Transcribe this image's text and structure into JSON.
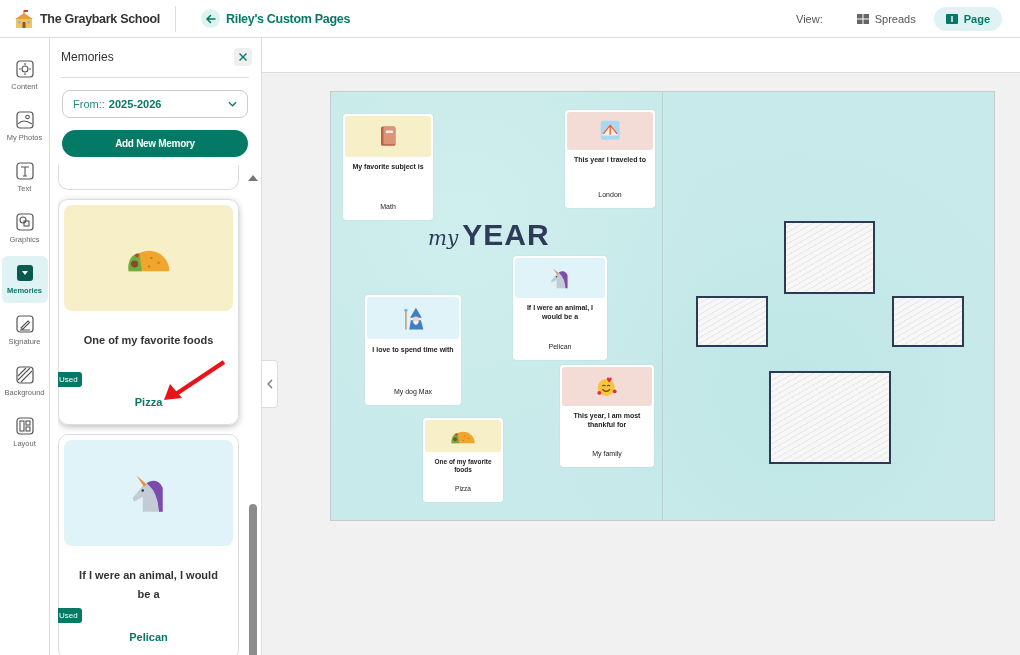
{
  "header": {
    "school": "The Graybark School",
    "back_title": "Riley's Custom Pages",
    "view_label": "View:",
    "view_options": [
      {
        "label": "Spreads",
        "selected": false
      },
      {
        "label": "Page",
        "selected": true
      }
    ]
  },
  "rail": [
    {
      "label": "Content",
      "selected": false
    },
    {
      "label": "My Photos",
      "selected": false
    },
    {
      "label": "Text",
      "selected": false
    },
    {
      "label": "Graphics",
      "selected": false
    },
    {
      "label": "Memories",
      "selected": true
    },
    {
      "label": "Signature",
      "selected": false
    },
    {
      "label": "Background",
      "selected": false
    },
    {
      "label": "Layout",
      "selected": false
    }
  ],
  "panel": {
    "title": "Memories",
    "from_label": "From::",
    "from_value": "2025-2026",
    "add_button": "Add New Memory",
    "memories": [
      {
        "prompt": "One of my favorite foods",
        "answer": "Pizza",
        "badge": "Used",
        "color": "#f7efc8",
        "highlighted": true
      },
      {
        "prompt": "If I were an animal, I would be a",
        "answer": "Pelican",
        "badge": "Used",
        "color": "#dff3f9",
        "highlighted": false
      }
    ]
  },
  "spread": {
    "title_script": "my",
    "title_bold": "YEAR",
    "cards": [
      {
        "prompt": "My favorite subject is",
        "answer": "Math",
        "color": "#f7efc8"
      },
      {
        "prompt": "This year I traveled to",
        "answer": "London",
        "color": "#f3dcd6"
      },
      {
        "prompt": "If I were an animal, I would be a",
        "answer": "Pelican",
        "color": "#dff3f9"
      },
      {
        "prompt": "I love to spend time with",
        "answer": "My dog Max",
        "color": "#dff3f9"
      },
      {
        "prompt": "This year, I am most thankful for",
        "answer": "My family",
        "color": "#f3dcd6"
      },
      {
        "prompt": "One of my favorite foods",
        "answer": "Pizza",
        "color": "#f7efc8"
      }
    ]
  }
}
